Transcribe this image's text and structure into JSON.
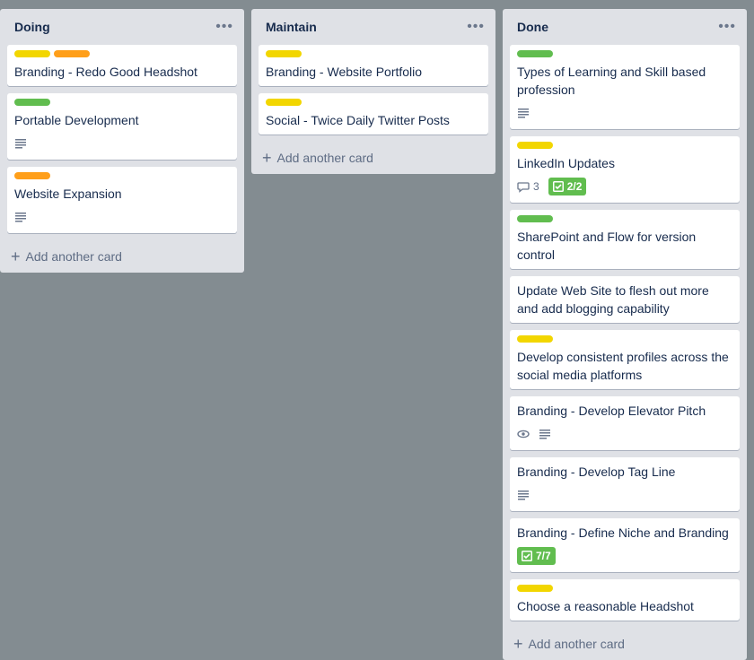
{
  "colors": {
    "green": "#61bd4f",
    "yellow": "#f2d600",
    "orange": "#ff9f1a"
  },
  "lists": [
    {
      "title": "Doing",
      "add_label": "Add another card",
      "cards": [
        {
          "title": "Branding - Redo Good Headshot",
          "labels": [
            "yellow",
            "orange"
          ]
        },
        {
          "title": "Portable Development",
          "labels": [
            "green"
          ],
          "description": true
        },
        {
          "title": "Website Expansion",
          "labels": [
            "orange"
          ],
          "description": true
        }
      ]
    },
    {
      "title": "Maintain",
      "add_label": "Add another card",
      "cards": [
        {
          "title": "Branding - Website Portfolio",
          "labels": [
            "yellow"
          ]
        },
        {
          "title": "Social - Twice Daily Twitter Posts",
          "labels": [
            "yellow"
          ]
        }
      ]
    },
    {
      "title": "Done",
      "add_label": "Add another card",
      "cards": [
        {
          "title": "Types of Learning and Skill based profession",
          "labels": [
            "green"
          ],
          "description": true
        },
        {
          "title": "LinkedIn Updates",
          "labels": [
            "yellow"
          ],
          "comments": "3",
          "checklist": "2/2"
        },
        {
          "title": "SharePoint and Flow for version control",
          "labels": [
            "green"
          ]
        },
        {
          "title": "Update Web Site to flesh out more and add blogging capability",
          "labels": []
        },
        {
          "title": "Develop consistent profiles across the social media platforms",
          "labels": [
            "yellow"
          ]
        },
        {
          "title": "Branding - Develop Elevator Pitch",
          "labels": [],
          "watching": true,
          "description": true
        },
        {
          "title": "Branding - Develop Tag Line",
          "labels": [],
          "description": true
        },
        {
          "title": "Branding - Define Niche and Branding",
          "labels": [],
          "checklist": "7/7"
        },
        {
          "title": "Choose a reasonable Headshot",
          "labels": [
            "yellow"
          ]
        }
      ]
    }
  ]
}
